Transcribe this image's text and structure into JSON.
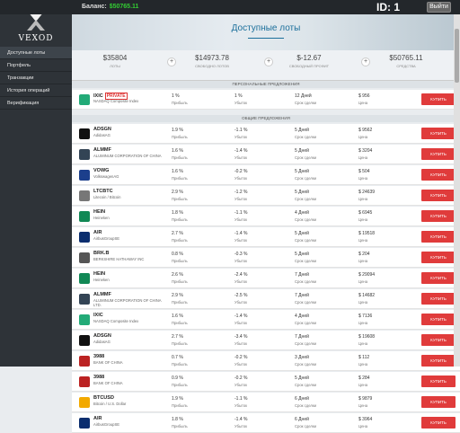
{
  "header": {
    "balance_label": "Баланс:",
    "balance_value": "$50765.11",
    "id_label": "ID: 1",
    "exit_label": "Выйти"
  },
  "logo": {
    "text": "VEXOD"
  },
  "nav": [
    {
      "label": "Доступные лоты",
      "active": true
    },
    {
      "label": "Портфель",
      "active": false
    },
    {
      "label": "Транзакции",
      "active": false
    },
    {
      "label": "История операций",
      "active": false
    },
    {
      "label": "Верификация",
      "active": false
    }
  ],
  "page": {
    "title": "Доступные лоты"
  },
  "stats": [
    {
      "value": "$35804",
      "label": "Лоты"
    },
    {
      "value": "$14973.78",
      "label": "Свободно лотов"
    },
    {
      "value": "$-12.67",
      "label": "Свободный профит"
    },
    {
      "value": "$50765.11",
      "label": "Средства"
    }
  ],
  "personal_header": "ПЕРСОНАЛЬНЫЕ ПРЕДЛОЖЕНИЯ",
  "personal": [
    {
      "ticker": "IXIC",
      "badge": "PRIVATE",
      "name": "NASDAQ Composite Index",
      "p1": "1 %",
      "p1_label": "Прибыль",
      "p2": "1 %",
      "p2_label": "Убыток",
      "p3": "12 Дней",
      "p3_label": "Срок сделки",
      "price": "$ 956",
      "price_label": "Цена",
      "buy": "КУПИТЬ",
      "icon_color": "#2a7"
    }
  ],
  "general_header": "ОБЩИЕ ПРЕДЛОЖЕНИЯ",
  "rows": [
    {
      "ticker": "ADSGN",
      "name": "AdidasAG",
      "p1": "1.9 %",
      "p2": "-1.1 %",
      "p3": "5 Дней",
      "price": "$ 9562",
      "icon_color": "#111"
    },
    {
      "ticker": "ALMMF",
      "name": "ALUMINUM CORPORATION OF CHINA",
      "p1": "1.6 %",
      "p2": "-1.4 %",
      "p3": "5 Дней",
      "price": "$ 3204",
      "icon_color": "#345"
    },
    {
      "ticker": "VOWG",
      "name": "VolkswagenAG",
      "p1": "1.6 %",
      "p2": "-0.2 %",
      "p3": "5 Дней",
      "price": "$ 504",
      "icon_color": "#1c3f8c"
    },
    {
      "ticker": "LTCBTC",
      "name": "Litecoin / Bitcoin",
      "p1": "2.9 %",
      "p2": "-1.2 %",
      "p3": "5 Дней",
      "price": "$ 24639",
      "icon_color": "#777"
    },
    {
      "ticker": "HEIN",
      "name": "Heineken",
      "p1": "1.8 %",
      "p2": "-1.1 %",
      "p3": "4 Дней",
      "price": "$ 6945",
      "icon_color": "#185"
    },
    {
      "ticker": "AIR",
      "name": "AirbusGroupSE",
      "p1": "2.7 %",
      "p2": "-1.4 %",
      "p3": "5 Дней",
      "price": "$ 19518",
      "icon_color": "#0a2d6e"
    },
    {
      "ticker": "BRK.B",
      "name": "BERKSHIRE HATHAWAY INC",
      "p1": "0.8 %",
      "p2": "-0.3 %",
      "p3": "5 Дней",
      "price": "$ 204",
      "icon_color": "#555"
    },
    {
      "ticker": "HEIN",
      "name": "Heineken",
      "p1": "2.6 %",
      "p2": "-2.4 %",
      "p3": "7 Дней",
      "price": "$ 29094",
      "icon_color": "#185"
    },
    {
      "ticker": "ALMMF",
      "name": "ALUMINUM CORPORATION OF CHINA LTD.",
      "p1": "2.9 %",
      "p2": "-2.5 %",
      "p3": "7 Дней",
      "price": "$ 14682",
      "icon_color": "#345"
    },
    {
      "ticker": "IXIC",
      "name": "NASDAQ Composite Index",
      "p1": "1.6 %",
      "p2": "-1.4 %",
      "p3": "4 Дней",
      "price": "$ 7136",
      "icon_color": "#2a7"
    },
    {
      "ticker": "ADSGN",
      "name": "AdidasAG",
      "p1": "2.7 %",
      "p2": "-3.4 %",
      "p3": "7 Дней",
      "price": "$ 19608",
      "icon_color": "#111"
    },
    {
      "ticker": "3988",
      "name": "BANK OF CHINA",
      "p1": "0.7 %",
      "p2": "-0.2 %",
      "p3": "3 Дней",
      "price": "$ 112",
      "icon_color": "#b22"
    },
    {
      "ticker": "3988",
      "name": "BANK OF CHINA",
      "p1": "0.9 %",
      "p2": "-0.2 %",
      "p3": "5 Дней",
      "price": "$ 284",
      "icon_color": "#b22"
    },
    {
      "ticker": "BTCUSD",
      "name": "Bitcoin / U.S. Dollar",
      "p1": "1.9 %",
      "p2": "-1.1 %",
      "p3": "6 Дней",
      "price": "$ 9879",
      "icon_color": "#f2a900"
    },
    {
      "ticker": "AIR",
      "name": "AirbusGroupSE",
      "p1": "1.8 %",
      "p2": "-1.4 %",
      "p3": "6 Дней",
      "price": "$ 3964",
      "icon_color": "#0a2d6e"
    }
  ],
  "labels": {
    "profit": "Прибыль",
    "loss": "Убыток",
    "term": "Срок сделки",
    "price": "Цена",
    "buy": "КУПИТЬ"
  }
}
